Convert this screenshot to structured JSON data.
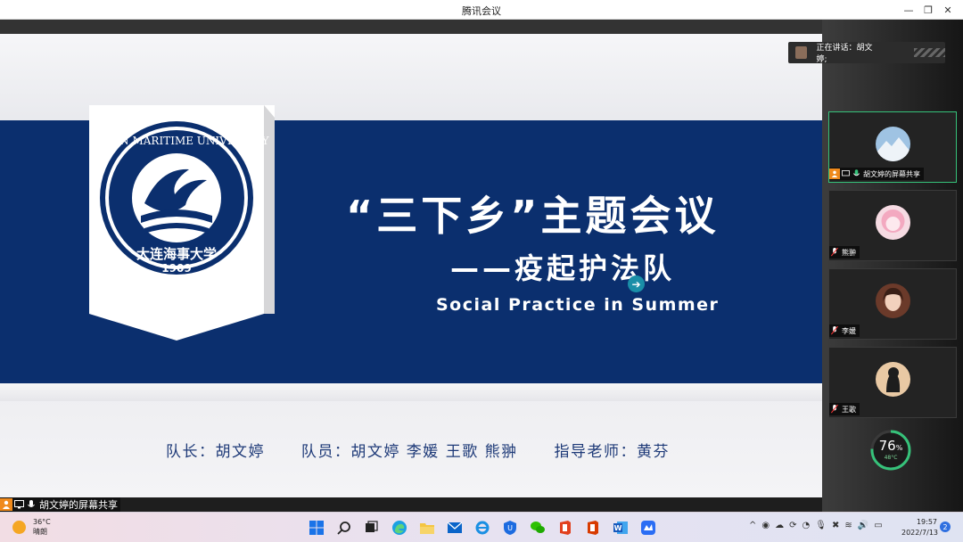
{
  "window": {
    "title": "腾讯会议"
  },
  "slide": {
    "title": "“三下乡”主题会议",
    "subtitle": "——疫起护法队",
    "english": "Social Practice in Summer",
    "logo_text_top": "DALIAN MARITIME UNIVERSITY",
    "logo_text_cn": "大连海事大学",
    "logo_year": "1909",
    "team": {
      "leader": "队长：胡文婷",
      "members": "队员：胡文婷 李媛 王歌 熊翀",
      "advisor": "指导老师：黄芬"
    }
  },
  "share_label": "胡文婷的屏幕共享",
  "speaking": {
    "label": "正在讲话：胡文婷;"
  },
  "participants": [
    {
      "name": "胡文婷的屏幕共享",
      "active": true
    },
    {
      "name": "熊翀",
      "active": false
    },
    {
      "name": "李媛",
      "active": false
    },
    {
      "name": "王歌",
      "active": false
    }
  ],
  "gauge": {
    "percent": "76",
    "unit": "%",
    "temp": "48°C",
    "level": 0.76
  },
  "taskbar": {
    "weather_temp": "36°C",
    "weather_desc": "晴朗",
    "time": "19:57",
    "date": "2022/7/13",
    "notifications": "2"
  },
  "colors": {
    "band": "#0b2f6e",
    "accent": "#36c27a",
    "text_blue": "#1e3a78"
  }
}
